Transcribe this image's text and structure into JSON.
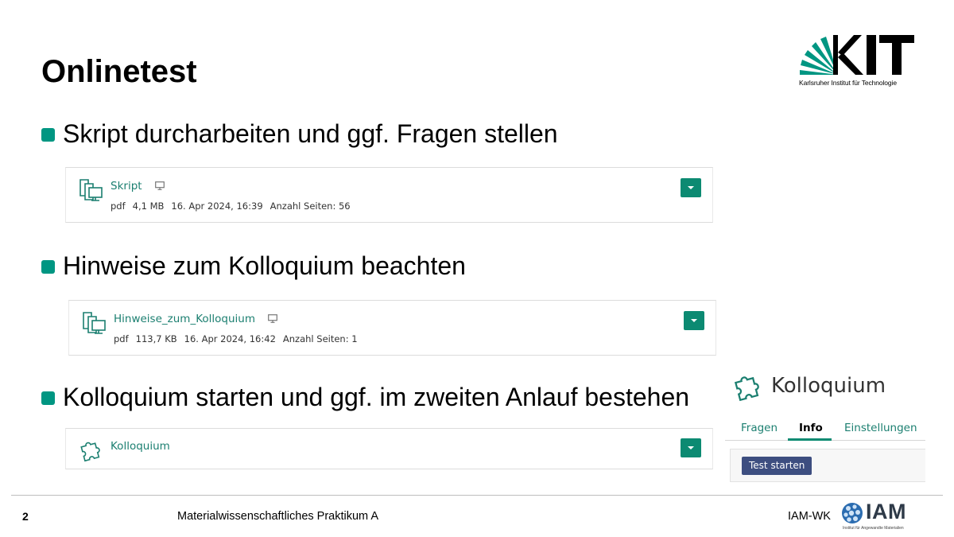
{
  "slide": {
    "title": "Onlinetest"
  },
  "logo": {
    "kit_wordmark": "KIT",
    "kit_subtitle": "Karlsruher Institut für Technologie"
  },
  "bullets": [
    "Skript durcharbeiten und ggf. Fragen stellen",
    "Hinweise zum Kolloquium beachten",
    "Kolloquium starten und ggf. im zweiten Anlauf bestehen"
  ],
  "files": [
    {
      "name": "Skript",
      "type": "pdf",
      "size": "4,1 MB",
      "date": "16. Apr 2024, 16:39",
      "pages": "Anzahl Seiten: 56",
      "icon": "file-copy-icon"
    },
    {
      "name": "Hinweise_zum_Kolloquium",
      "type": "pdf",
      "size": "113,7 KB",
      "date": "16. Apr 2024, 16:42",
      "pages": "Anzahl Seiten: 1",
      "icon": "file-copy-icon"
    },
    {
      "name": "Kolloquium",
      "icon": "puzzle-icon"
    }
  ],
  "kolloquium_panel": {
    "title": "Kolloquium",
    "tabs": [
      "Fragen",
      "Info",
      "Einstellungen"
    ],
    "active_tab": "Info",
    "start_button": "Test starten"
  },
  "footer": {
    "page_number": "2",
    "course": "Materialwissenschaftliches Praktikum A",
    "institute": "IAM-WK",
    "iam_wordmark": "IAM",
    "iam_subtitle": "Institut für Angewandte Materialien"
  },
  "colors": {
    "accent": "#009682",
    "link": "#1b7f70",
    "button": "#0c8a72",
    "start_button": "#3d4e80",
    "iam_blue": "#2b6cb0"
  }
}
